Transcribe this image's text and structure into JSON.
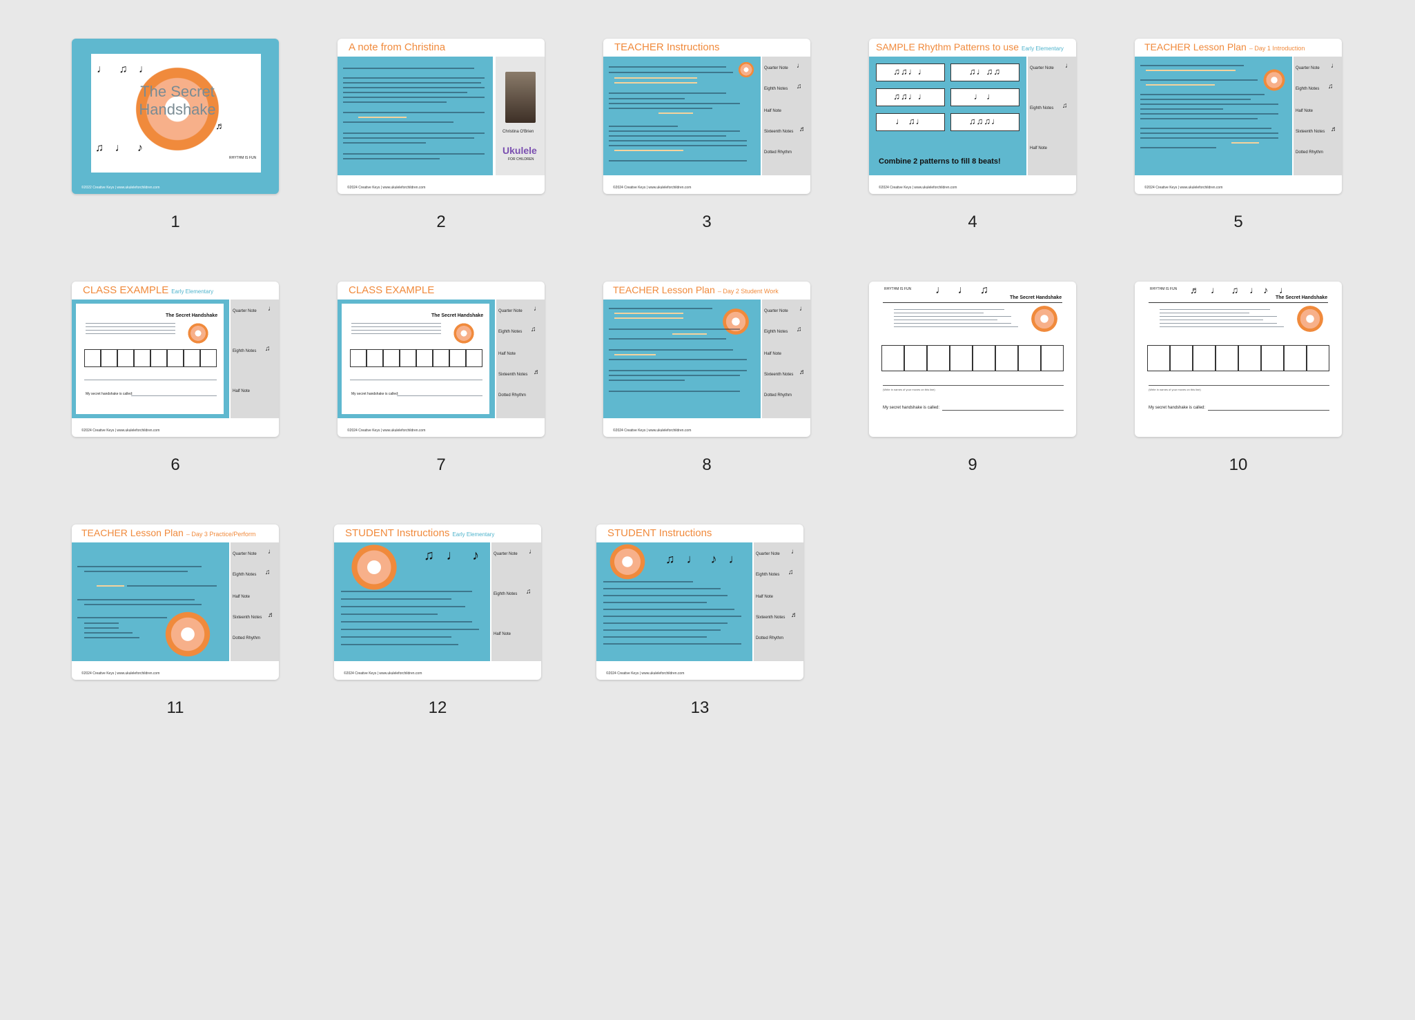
{
  "colors": {
    "accent": "#f08a3c",
    "teal": "#5fb8cf",
    "panel": "#dadada",
    "background": "#e8e8e8"
  },
  "slides": [
    {
      "number": "1",
      "title": "The Secret Handshake",
      "footer": "©2022 Creative Keys  |  www.ukuleleforchildren.com",
      "stamp": "RHYTHM IS FUN"
    },
    {
      "number": "2",
      "title": "A note from Christina",
      "footer": "©2024 Creative Keys  |  www.ukuleleforchildren.com",
      "signature": "Christina O'Brien",
      "logo": "Ukulele",
      "logo_sub": "FOR CHILDREN"
    },
    {
      "number": "3",
      "title": "TEACHER Instructions",
      "footer": "©2024 Creative Keys  |  www.ukuleleforchildren.com"
    },
    {
      "number": "4",
      "title": "SAMPLE Rhythm Patterns to use",
      "subtitle": "Early Elementary",
      "footer": "©2024 Creative Keys  |  www.ukuleleforchildren.com",
      "combine_text": "Combine 2 patterns to fill 8 beats!"
    },
    {
      "number": "5",
      "title": "TEACHER Lesson Plan",
      "subtitle": "– Day 1 Introduction",
      "footer": "©2024 Creative Keys  |  www.ukuleleforchildren.com"
    },
    {
      "number": "6",
      "title": "CLASS EXAMPLE",
      "subtitle": "Early Elementary",
      "footer": "©2024 Creative Keys  |  www.ukuleleforchildren.com",
      "sheet_title": "The Secret Handshake",
      "sheet_line": "My secret handshake is called:"
    },
    {
      "number": "7",
      "title": "CLASS EXAMPLE",
      "footer": "©2024 Creative Keys  |  www.ukuleleforchildren.com",
      "sheet_title": "The Secret Handshake",
      "sheet_line": "My secret handshake is called:"
    },
    {
      "number": "8",
      "title": "TEACHER Lesson Plan",
      "subtitle": "– Day 2 Student Work",
      "footer": "©2024 Creative Keys  |  www.ukuleleforchildren.com"
    },
    {
      "number": "9",
      "sheet_title": "The Secret Handshake",
      "sheet_line": "My secret handshake is called:",
      "stamp": "RHYTHM IS FUN",
      "note_hint": "(Write in names of your moves on this line)"
    },
    {
      "number": "10",
      "sheet_title": "The Secret Handshake",
      "sheet_line": "My secret handshake is called:",
      "stamp": "RHYTHM IS FUN",
      "note_hint": "(Write in names of your moves on this line)"
    },
    {
      "number": "11",
      "title": "TEACHER Lesson Plan",
      "subtitle": "– Day 3 Practice/Perform",
      "footer": "©2024 Creative Keys  |  www.ukuleleforchildren.com"
    },
    {
      "number": "12",
      "title": "STUDENT Instructions",
      "subtitle": "Early Elementary",
      "footer": "©2024 Creative Keys  |  www.ukuleleforchildren.com"
    },
    {
      "number": "13",
      "title": "STUDENT Instructions",
      "footer": "©2024 Creative Keys  |  www.ukuleleforchildren.com"
    }
  ],
  "reference": {
    "quarter": "Quarter Note",
    "eighth": "Eighth Notes",
    "half": "Half Note",
    "sixteenth": "Sixteenth Notes",
    "dotted": "Dotted Rhythm"
  },
  "glyphs": {
    "quarter": "♩",
    "eighth": "♫",
    "sixteenth": "♬",
    "half": "𝅗𝅥"
  }
}
